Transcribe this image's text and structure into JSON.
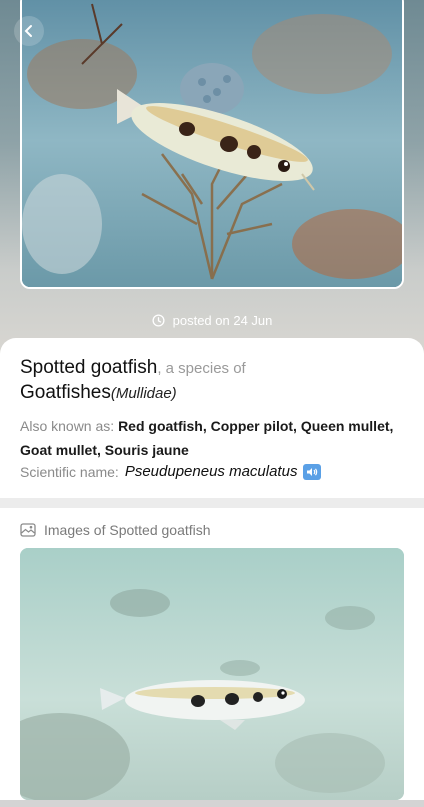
{
  "post": {
    "posted_text": "posted on 24 Jun"
  },
  "species": {
    "common_name": "Spotted goatfish",
    "species_of_text": ", a species of",
    "family_name": "Goatfishes",
    "family_latin": "(Mullidae)",
    "aka_label": "Also known as: ",
    "aka_names": "Red goatfish, Copper pilot, Queen mullet, Goat mullet, Souris jaune",
    "sci_label": "Scientific name: ",
    "sci_name": "Pseudupeneus maculatus"
  },
  "images_section": {
    "title": "Images of Spotted goatfish"
  },
  "icons": {
    "back": "chevron-left-icon",
    "clock": "clock-icon",
    "speaker": "speaker-icon",
    "gallery": "gallery-icon"
  },
  "colors": {
    "accent_speaker": "#5aa0e6"
  }
}
